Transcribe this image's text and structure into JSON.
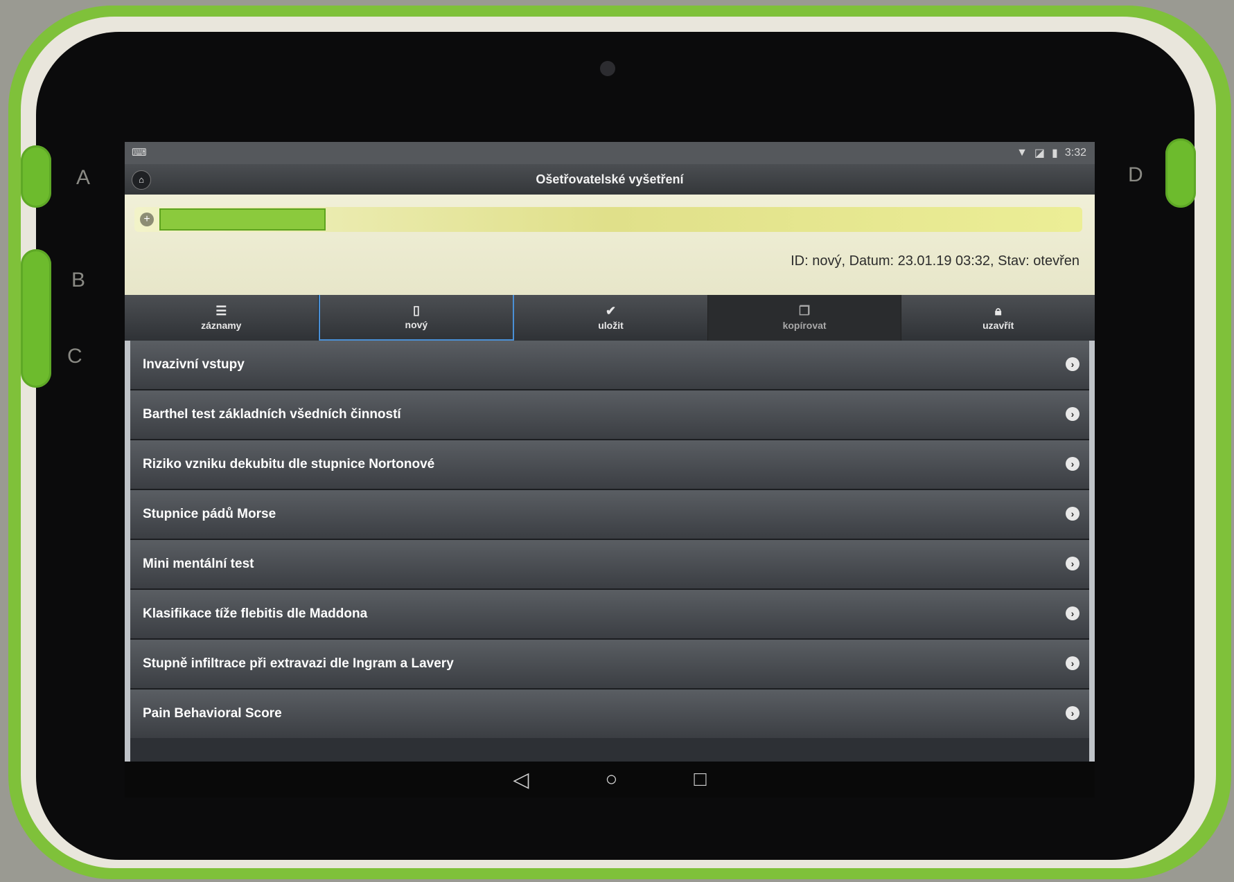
{
  "device": {
    "side_letters": [
      "A",
      "B",
      "C",
      "D"
    ]
  },
  "statusbar": {
    "time": "3:32"
  },
  "header": {
    "title": "Ošetřovatelské vyšetření"
  },
  "patient": {
    "meta": "ID: nový, Datum: 23.01.19 03:32, Stav: otevřen"
  },
  "toolbar": {
    "items": [
      {
        "label": "záznamy",
        "icon": "list-icon"
      },
      {
        "label": "nový",
        "icon": "document-icon"
      },
      {
        "label": "uložit",
        "icon": "check-icon"
      },
      {
        "label": "kopírovat",
        "icon": "copy-icon"
      },
      {
        "label": "uzavřít",
        "icon": "lock-icon"
      }
    ]
  },
  "list": {
    "items": [
      "Invazivní vstupy",
      "Barthel test základních všedních činností",
      "Riziko vzniku dekubitu dle stupnice Nortonové",
      "Stupnice pádů Morse",
      "Mini mentální test",
      "Klasifikace tíže flebitis dle Maddona",
      "Stupně infiltrace při extravazi dle Ingram a Lavery",
      "Pain Behavioral Score"
    ]
  },
  "colors": {
    "accent_green": "#8bca3d",
    "active_tab_border": "#4a90d6",
    "header_bg": "#3f4246"
  }
}
